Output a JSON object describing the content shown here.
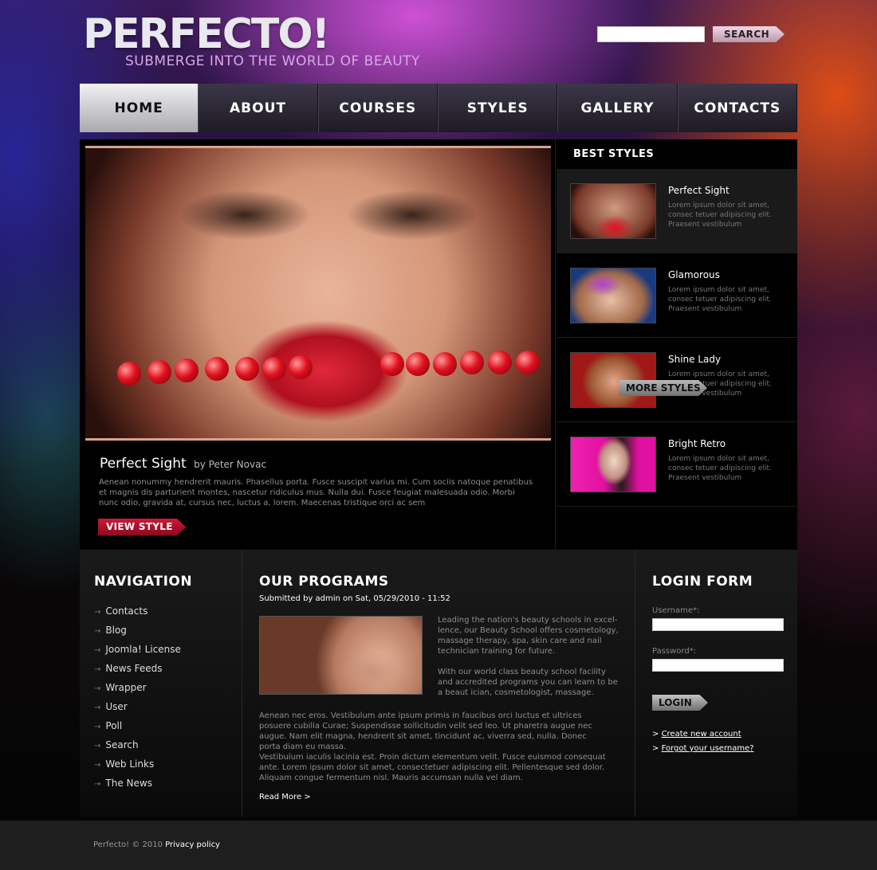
{
  "header": {
    "logo": "PERFECTO!",
    "tagline": "SUBMERGE INTO THE WORLD OF BEAUTY",
    "search_placeholder": "",
    "search_label": "SEARCH"
  },
  "nav": [
    "HOME",
    "ABOUT",
    "COURSES",
    "STYLES",
    "GALLERY",
    "CONTACTS"
  ],
  "feature": {
    "title": "Perfect Sight",
    "by": "by Peter Novac",
    "text": "Aenean nonummy hendrerit mauris. Phasellus porta. Fusce suscipit varius mi. Cum sociis natoque penatibus et magnis dis parturient montes, nascetur ridiculus mus. Nulla dui. Fusce feugiat malesuada odio. Morbi nunc odio, gravida at, cursus nec, luctus a, lorem. Maecenas tristique orci ac sem",
    "button": "VIEW STYLE"
  },
  "best_styles": {
    "title": "BEST STYLES",
    "items": [
      {
        "name": "Perfect Sight",
        "desc": "Lorem ipsum dolor sit amet, consec tetuer adipiscing elit. Praesent vestibulum"
      },
      {
        "name": "Glamorous",
        "desc": "Lorem ipsum dolor sit amet, consec tetuer adipiscing elit. Praesent vestibulum"
      },
      {
        "name": "Shine Lady",
        "desc": "Lorem ipsum dolor sit amet, consec tetuer adipiscing elit. Praesent vestibulum"
      },
      {
        "name": "Bright Retro",
        "desc": "Lorem ipsum dolor sit amet, consec tetuer adipiscing elit. Praesent vestibulum"
      }
    ],
    "more": "MORE STYLES"
  },
  "navigation": {
    "title": "NAVIGATION",
    "items": [
      "Contacts",
      "Blog",
      "Joomla! License",
      "News Feeds",
      "Wrapper",
      "User",
      "Poll",
      "Search",
      "Web Links",
      "The News"
    ]
  },
  "programs": {
    "title": "OUR PROGRAMS",
    "submitted": "Submitted by admin on Sat, 05/29/2010 - 11:52",
    "text1": "Leading the nation's beauty schools in excel-lence, our Beauty School offers cosmetology, massage therapy, spa, skin care and nail technician training for future.",
    "text2": "With our world class beauty school facility and accredited programs you can learn to be a beaut ician, cosmetologist, massage.",
    "text3": "Aenean nec eros. Vestibulum ante ipsum primis in faucibus orci luctus et ultrices posuere cubilia Curae; Suspendisse sollicitudin velit sed leo. Ut pharetra augue nec augue. Nam elit magna, hendrerit sit amet, tincidunt ac, viverra sed, nulla. Donec porta diam eu massa.",
    "text4": "Vestibulum iaculis lacinia est. Proin dictum elementum velit. Fusce euismod consequat ante. Lorem ipsum dolor sit amet, consectetuer adipiscing elit. Pellentesque sed dolor. Aliquam congue fermentum nisl. Mauris accumsan nulla vel diam.",
    "read_more": "Read More >"
  },
  "login": {
    "title": "LOGIN FORM",
    "username_label": "Username*:",
    "password_label": "Password*:",
    "button": "LOGIN",
    "create_account": "Create new account",
    "forgot": "Forgot your username?"
  },
  "footer": {
    "copyright": "Perfecto! © 2010",
    "privacy": "Privacy policy"
  }
}
